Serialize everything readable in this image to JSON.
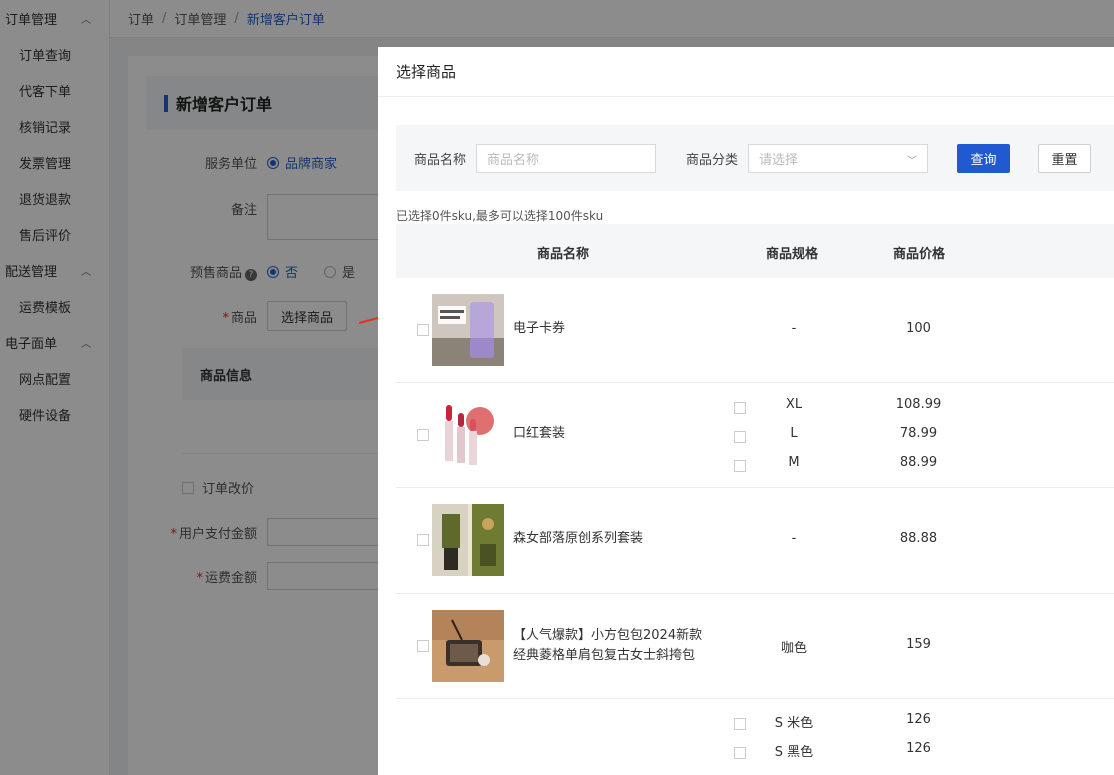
{
  "sidebar": {
    "groups": [
      {
        "label": "订单管理",
        "items": [
          "订单查询",
          "代客下单",
          "核销记录",
          "发票管理",
          "退货退款",
          "售后评价"
        ]
      },
      {
        "label": "配送管理",
        "items": [
          "运费模板"
        ]
      },
      {
        "label": "电子面单",
        "items": [
          "网点配置",
          "硬件设备"
        ]
      }
    ]
  },
  "breadcrumb": [
    "订单",
    "订单管理",
    "新增客户订单"
  ],
  "page": {
    "title": "新增客户订单",
    "service_label": "服务单位",
    "service_option": "品牌商家",
    "remark_label": "备注",
    "presale_label": "预售商品",
    "presale_yes": "是",
    "presale_no": "否",
    "goods_label": "商品",
    "select_goods_btn": "选择商品",
    "goods_info_header": "商品信息",
    "modify_price_label": "订单改价",
    "pay_amount_label": "用户支付金额",
    "shipping_label": "运费金额"
  },
  "drawer": {
    "title": "选择商品",
    "search": {
      "name_label": "商品名称",
      "name_placeholder": "商品名称",
      "category_label": "商品分类",
      "category_placeholder": "请选择",
      "query_btn": "查询",
      "reset_btn": "重置"
    },
    "select_hint": "已选择0件sku,最多可以选择100件sku",
    "columns": {
      "name": "商品名称",
      "spec": "商品规格",
      "price": "商品价格"
    },
    "products": [
      {
        "name": "电子卡券",
        "skus": [
          {
            "spec": "-",
            "price": "100"
          }
        ]
      },
      {
        "name": "口红套装",
        "skus": [
          {
            "spec": "XL",
            "price": "108.99"
          },
          {
            "spec": "L",
            "price": "78.99"
          },
          {
            "spec": "M",
            "price": "88.99"
          }
        ]
      },
      {
        "name": "森女部落原创系列套装",
        "skus": [
          {
            "spec": "-",
            "price": "88.88"
          }
        ]
      },
      {
        "name": "【人气爆款】小方包包2024新款经典菱格单肩包复古女士斜挎包",
        "skus": [
          {
            "spec": "咖色",
            "price": "159"
          }
        ]
      },
      {
        "name": "",
        "skus": [
          {
            "spec": "S 米色",
            "price": "126"
          },
          {
            "spec": "S 黑色",
            "price": "126"
          }
        ]
      }
    ]
  }
}
